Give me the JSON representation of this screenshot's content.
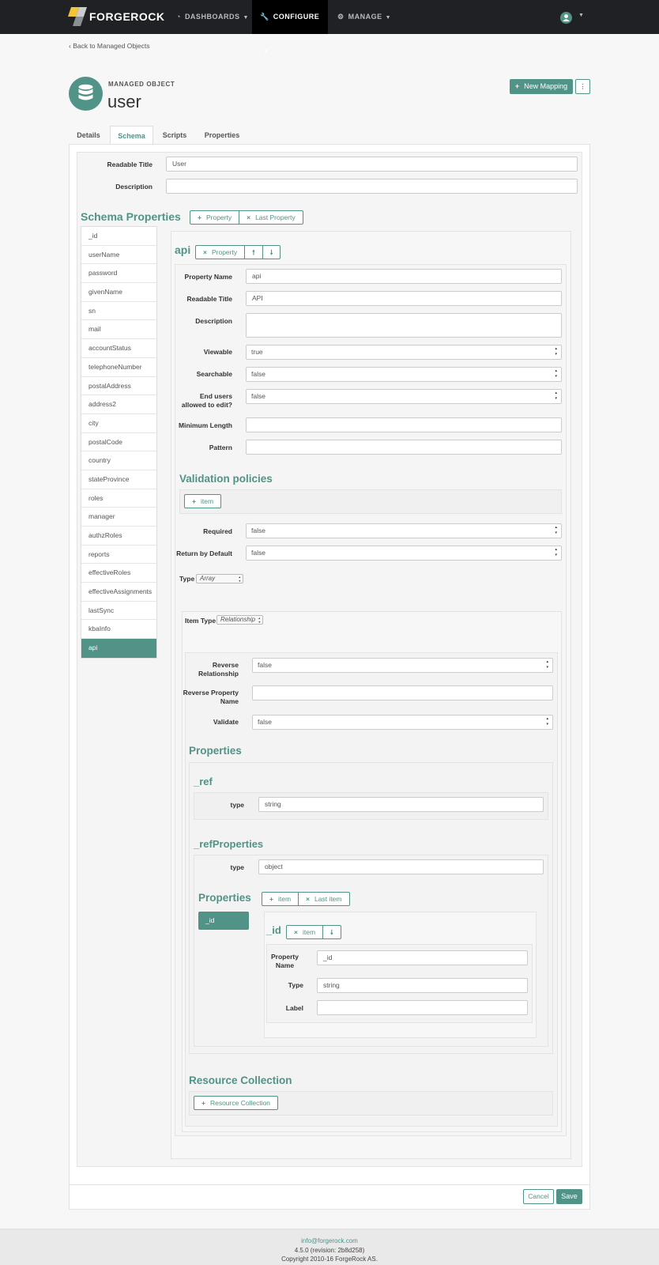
{
  "nav": {
    "brand": "FORGEROCK",
    "items": [
      {
        "label": "DASHBOARDS",
        "icon": "dashboard-icon"
      },
      {
        "label": "CONFIGURE",
        "icon": "wrench-icon"
      },
      {
        "label": "MANAGE",
        "icon": "cogs-icon"
      }
    ]
  },
  "back_link": "‹ Back to Managed Objects",
  "header": {
    "kicker": "MANAGED OBJECT",
    "title": "user",
    "new_mapping": "New Mapping"
  },
  "tabs": [
    "Details",
    "Schema",
    "Scripts",
    "Properties"
  ],
  "object": {
    "readable_title_label": "Readable Title",
    "readable_title_value": "User",
    "description_label": "Description",
    "description_value": ""
  },
  "schema": {
    "heading": "Schema Properties",
    "add_property": "Property",
    "last_property": "Last Property",
    "properties": [
      "_id",
      "userName",
      "password",
      "givenName",
      "sn",
      "mail",
      "accountStatus",
      "telephoneNumber",
      "postalAddress",
      "address2",
      "city",
      "postalCode",
      "country",
      "stateProvince",
      "roles",
      "manager",
      "authzRoles",
      "reports",
      "effectiveRoles",
      "effectiveAssignments",
      "lastSync",
      "kbaInfo",
      "api"
    ]
  },
  "prop": {
    "title": "api",
    "remove_label": "Property",
    "fields": {
      "property_name_label": "Property Name",
      "property_name": "api",
      "readable_title_label": "Readable Title",
      "readable_title": "API",
      "description_label": "Description",
      "description": "",
      "viewable_label": "Viewable",
      "viewable": "true",
      "searchable_label": "Searchable",
      "searchable": "false",
      "end_users_label": "End users allowed to edit?",
      "end_users": "false",
      "min_length_label": "Minimum Length",
      "min_length": "",
      "pattern_label": "Pattern",
      "pattern": ""
    },
    "validation_heading": "Validation policies",
    "add_item": "item",
    "required_label": "Required",
    "required": "false",
    "return_default_label": "Return by Default",
    "return_default": "false",
    "type_label": "Type",
    "type": "Array",
    "item_type_label": "Item Type",
    "item_type": "Relationship",
    "reverse_rel_label": "Reverse Relationship",
    "reverse_rel": "false",
    "reverse_prop_label": "Reverse Property Name",
    "reverse_prop": "",
    "validate_label": "Validate",
    "validate": "false",
    "properties_heading": "Properties",
    "ref_heading": "_ref",
    "ref_type_label": "type",
    "ref_type": "string",
    "refprops_heading": "_refProperties",
    "refprops_type_label": "type",
    "refprops_type": "object",
    "inner_properties_heading": "Properties",
    "inner_add_item": "item",
    "inner_last_item": "Last item",
    "inner_list": [
      "_id"
    ],
    "id_heading": "_id",
    "id_remove": "item",
    "id_prop_name_label": "Property Name",
    "id_prop_name": "_id",
    "id_type_label": "Type",
    "id_type": "string",
    "id_label_label": "Label",
    "id_label": "",
    "resource_heading": "Resource Collection",
    "resource_button": "Resource Collection"
  },
  "actions": {
    "cancel": "Cancel",
    "save": "Save"
  },
  "footer": {
    "email": "info@forgerock.com",
    "version": "4.5.0 (revision: 2b8d258)",
    "copyright": "Copyright 2010-16 ForgeRock AS."
  },
  "colors": {
    "accent": "#519387",
    "nav_bg": "#1f2124"
  }
}
